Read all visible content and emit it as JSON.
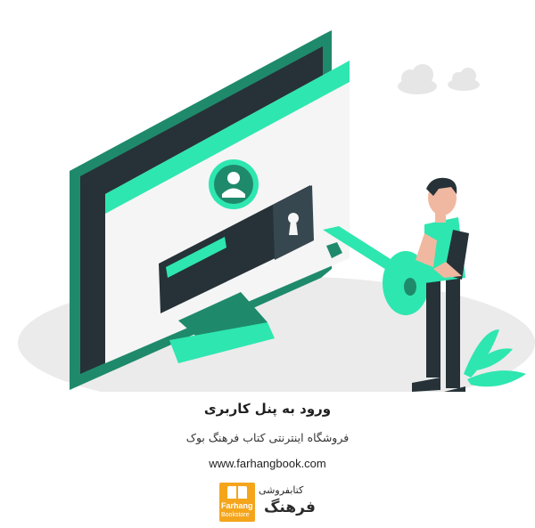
{
  "heading": {
    "title": "ورود به پنل کاربری",
    "subtitle": "فروشگاه اینترنتی کتاب فرهنگ بوک",
    "url": "www.farhangbook.com"
  },
  "logo": {
    "top_text": "کتابفروشی",
    "main_text": "فرهنگ",
    "english_name": "Farhang",
    "english_sub": "Bookstore",
    "accent_color": "#f4a51c"
  },
  "illustration": {
    "icons": [
      "monitor",
      "user-avatar-icon",
      "password-field",
      "keyhole-icon",
      "key",
      "person",
      "cloud-icon",
      "plant"
    ],
    "colors": {
      "accent": "#2ee6b0",
      "dark_teal": "#1f8a6b",
      "screen_dark": "#263238",
      "light_gray": "#ebebeb"
    }
  }
}
